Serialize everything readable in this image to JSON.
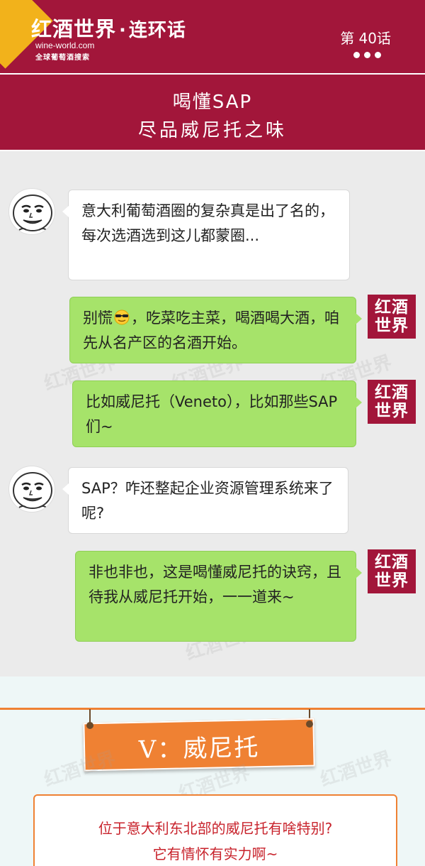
{
  "header": {
    "logo_main": "红酒世界",
    "logo_sep": "·",
    "series_name": "连环话",
    "logo_url": "wine-world.com",
    "logo_tagline": "全球葡萄酒搜索",
    "episode": "第 40话"
  },
  "title": {
    "line1": "喝懂SAP",
    "line2": "尽品威尼托之味"
  },
  "brand_avatar": {
    "line1": "红酒",
    "line2": "世界"
  },
  "chat": {
    "messages": [
      {
        "side": "left",
        "text": "意大利葡萄酒圈的复杂真是出了名的，每次选酒选到这儿都蒙圈..."
      },
      {
        "side": "right",
        "text_before": "别慌",
        "text_after": "，吃菜吃主菜，喝酒喝大酒，咱先从名产区的名酒开始。",
        "emoji": "cool-face-emoji"
      },
      {
        "side": "right",
        "text": "比如威尼托（Veneto），比如那些SAP们~"
      },
      {
        "side": "left",
        "text": "SAP？咋还整起企业资源管理系统来了呢?"
      },
      {
        "side": "right",
        "text": "非也非也，这是喝懂威尼托的诀窍，且待我从威尼托开始，一一道来~"
      }
    ]
  },
  "section": {
    "banner": "V：威尼托",
    "card_line1": "位于意大利东北部的威尼托有啥特别?",
    "card_line2": "它有情怀有实力啊~"
  },
  "colors": {
    "brand_red": "#a2163a",
    "accent_yellow": "#f2b21b",
    "bubble_green": "#a6e36a",
    "section_orange": "#ef8133",
    "card_text_red": "#c8232c"
  }
}
